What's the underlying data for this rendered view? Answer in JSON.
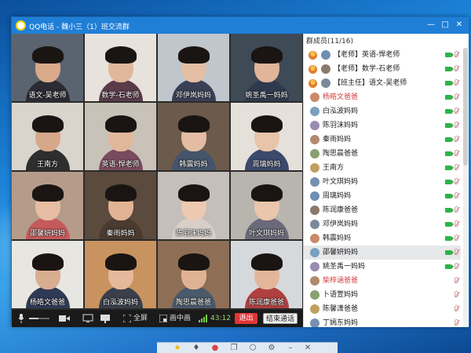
{
  "window": {
    "title": "QQ电话 - 魏小三（1）班交流群",
    "minimize": "—",
    "maximize": "□",
    "close": "✕"
  },
  "tiles": [
    {
      "caption": "语文-吴老师"
    },
    {
      "caption": "数学-石老师"
    },
    {
      "caption": "邓伊岚妈妈"
    },
    {
      "caption": "姚圣禹一妈妈"
    },
    {
      "caption": "王南方"
    },
    {
      "caption": "英语-悍老师"
    },
    {
      "caption": "韩震妈妈"
    },
    {
      "caption": "周璃妈妈"
    },
    {
      "caption": "邵馨妍妈妈"
    },
    {
      "caption": "秦雨妈妈"
    },
    {
      "caption": "陈羽沫妈妈"
    },
    {
      "caption": "叶文琪妈妈"
    },
    {
      "caption": "杨皓文爸爸"
    },
    {
      "caption": "白泓波妈妈"
    },
    {
      "caption": "陶思晨爸爸"
    },
    {
      "caption": "陈润康爸爸"
    }
  ],
  "controls": {
    "fullscreen": "全屏",
    "pip": "画中画",
    "timer": "43:12",
    "exit": "退出",
    "end_call": "结束通话"
  },
  "members": {
    "header": "群成员(11/16)",
    "items": [
      {
        "name": "【老师】英语-悍老师",
        "color": "#222222"
      },
      {
        "name": "【老师】数学-石老师",
        "color": "#222222"
      },
      {
        "name": "【班主任】语文-吴老师",
        "color": "#222222"
      },
      {
        "name": "杨皓文爸爸",
        "color": "#d23c3c"
      },
      {
        "name": "白泓波妈妈",
        "color": "#222222"
      },
      {
        "name": "陈羽沫妈妈",
        "color": "#222222"
      },
      {
        "name": "秦雨妈妈",
        "color": "#222222"
      },
      {
        "name": "陶思晨爸爸",
        "color": "#222222"
      },
      {
        "name": "王南方",
        "color": "#222222"
      },
      {
        "name": "叶文琪妈妈",
        "color": "#222222"
      },
      {
        "name": "周璃妈妈",
        "color": "#222222"
      },
      {
        "name": "陈润康爸爸",
        "color": "#222222"
      },
      {
        "name": "邓伊岚妈妈",
        "color": "#222222"
      },
      {
        "name": "韩震妈妈",
        "color": "#222222"
      },
      {
        "name": "邵馨妍妈妈",
        "color": "#222222"
      },
      {
        "name": "姚圣禹一妈妈",
        "color": "#222222"
      },
      {
        "name": "柴梓涵爸爸",
        "color": "#d23c3c"
      },
      {
        "name": "卜语萱妈妈",
        "color": "#222222"
      },
      {
        "name": "陈馨潇爸爸",
        "color": "#222222"
      },
      {
        "name": "丁嫣东妈妈",
        "color": "#222222"
      }
    ]
  },
  "colors": {
    "titlebar": "#1f7fd7",
    "exit_button": "#e03535",
    "camera_on": "#2fb34a"
  }
}
